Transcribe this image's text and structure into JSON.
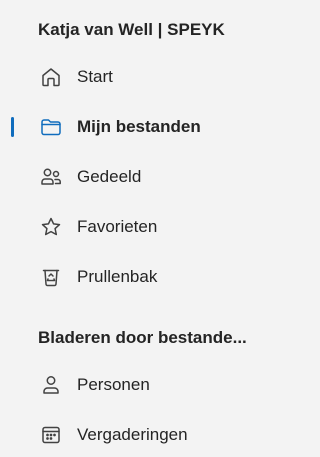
{
  "account": {
    "title": "Katja van Well | SPEYK"
  },
  "nav": {
    "items": [
      {
        "label": "Start",
        "icon": "home-icon",
        "selected": false
      },
      {
        "label": "Mijn bestanden",
        "icon": "folder-icon",
        "selected": true
      },
      {
        "label": "Gedeeld",
        "icon": "people-icon",
        "selected": false
      },
      {
        "label": "Favorieten",
        "icon": "star-icon",
        "selected": false
      },
      {
        "label": "Prullenbak",
        "icon": "recycle-bin-icon",
        "selected": false
      }
    ]
  },
  "browse": {
    "title": "Bladeren door bestande...",
    "items": [
      {
        "label": "Personen",
        "icon": "person-icon"
      },
      {
        "label": "Vergaderingen",
        "icon": "calendar-icon"
      }
    ]
  },
  "colors": {
    "accent": "#0f6cbd",
    "background": "#f3f3f3",
    "text": "#242424"
  }
}
